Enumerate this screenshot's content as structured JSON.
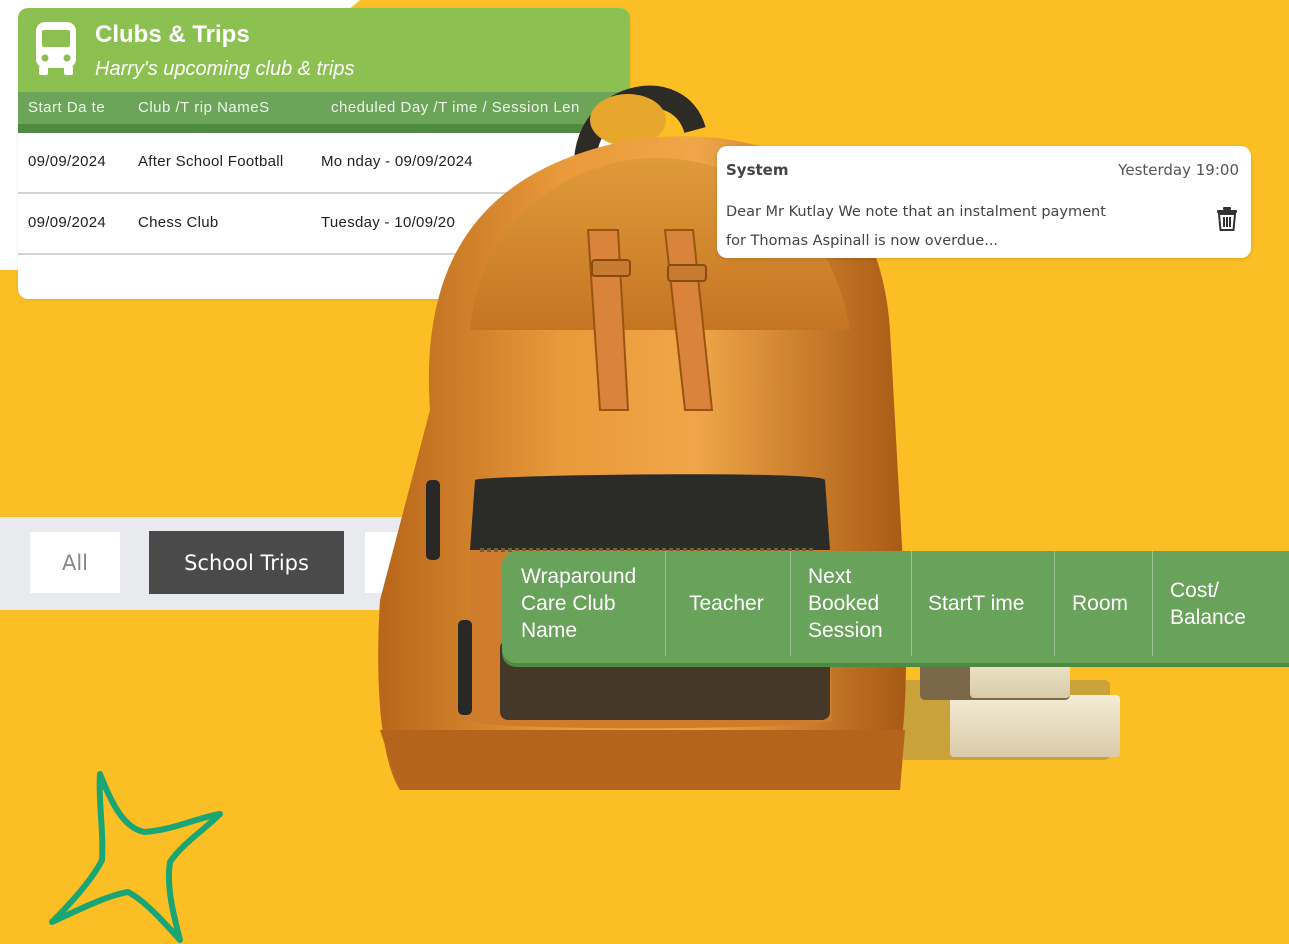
{
  "clubs_card": {
    "title": "Clubs & Trips",
    "subtitle": "Harry's upcoming club & trips",
    "columns": [
      "Start Da te",
      "Club /T rip NameS",
      "cheduled Day /T ime / Session Len"
    ],
    "rows": [
      {
        "start_date": "09/09/2024",
        "name": "After School Football",
        "schedule": "Mo nday - 09/09/2024"
      },
      {
        "start_date": "09/09/2024",
        "name": "Chess Club",
        "schedule": "Tuesday - 10/09/20"
      }
    ]
  },
  "notification": {
    "sender": "System",
    "time": "Yesterday 19:00",
    "line1": "Dear Mr Kutlay We note that an instalment payment",
    "line2": "for Thomas Aspinall is now overdue...",
    "icon": "trash-icon"
  },
  "filters": {
    "all_label": "All",
    "trips_label": "School Trips"
  },
  "wraparound_table": {
    "columns": [
      {
        "l1": "Wraparound",
        "l2": "Care Club",
        "l3": "Name"
      },
      {
        "l1": "Teacher"
      },
      {
        "l1": "Next",
        "l2": "Booked",
        "l3": "Session"
      },
      {
        "l1": "StartT ime"
      },
      {
        "l1": "Room"
      },
      {
        "l1": "Cost/",
        "l2": "Balance"
      }
    ]
  },
  "colors": {
    "background": "#fbbe24",
    "header_green": "#8cc152",
    "table_green": "#69a35b",
    "dark_button": "#4a4a4a"
  }
}
